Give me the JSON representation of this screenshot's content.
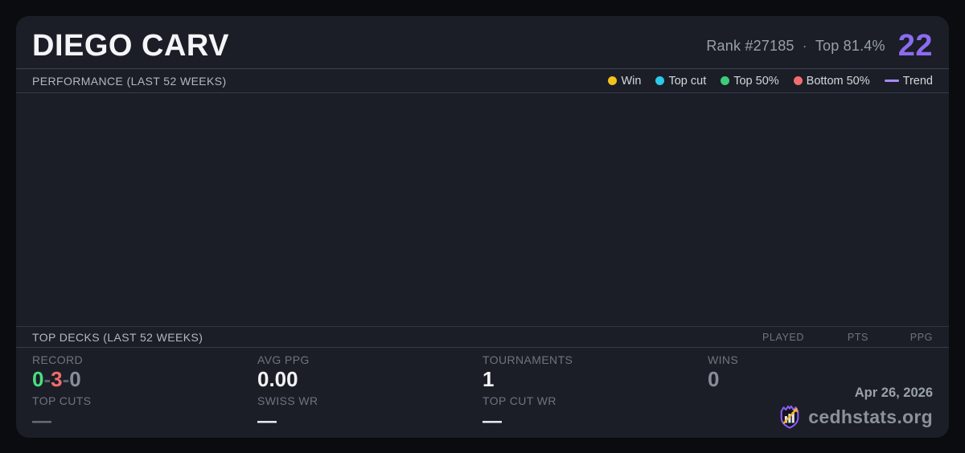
{
  "header": {
    "player_name": "DIEGO CARV",
    "rank_label": "Rank #27185",
    "separator": "·",
    "top_percent": "Top 81.4%",
    "score": "22"
  },
  "performance": {
    "title": "PERFORMANCE (LAST 52 WEEKS)",
    "legend": [
      {
        "label": "Win",
        "color": "#f2c21d",
        "swatch": "dot"
      },
      {
        "label": "Top cut",
        "color": "#2cc9e9",
        "swatch": "dot"
      },
      {
        "label": "Top 50%",
        "color": "#3ecc7a",
        "swatch": "dot"
      },
      {
        "label": "Bottom 50%",
        "color": "#f26d6d",
        "swatch": "dot"
      },
      {
        "label": "Trend",
        "color": "#a78bfa",
        "swatch": "line"
      }
    ],
    "chart_empty": true
  },
  "top_decks": {
    "title": "TOP DECKS (LAST 52 WEEKS)",
    "columns": [
      "PLAYED",
      "PTS",
      "PPG"
    ],
    "rows": []
  },
  "stats": {
    "record": {
      "label": "RECORD",
      "win": "0",
      "loss": "3",
      "draw": "0",
      "sep": "-"
    },
    "top_cuts": {
      "label": "TOP CUTS",
      "value": "—"
    },
    "avg_ppg": {
      "label": "AVG PPG",
      "value": "0.00"
    },
    "swiss_wr": {
      "label": "SWISS WR",
      "value": "—"
    },
    "tournaments": {
      "label": "TOURNAMENTS",
      "value": "1"
    },
    "top_cut_wr": {
      "label": "TOP CUT WR",
      "value": "—"
    },
    "wins": {
      "label": "WINS",
      "value": "0"
    }
  },
  "footer": {
    "date": "Apr 26, 2026",
    "site": "cedhstats.org"
  },
  "colors": {
    "page_bg": "#0b0c10",
    "card_bg": "#1b1e27",
    "accent_purple": "#8b6cf0",
    "win_yellow": "#f2c21d",
    "top_cut_cyan": "#2cc9e9",
    "top50_green": "#3ecc7a",
    "bottom50_red": "#f26d6d",
    "trend_lavender": "#a78bfa",
    "record_win_green": "#4ade80",
    "record_loss_red": "#f06c6c",
    "logo_shield_purple": "#8a5cf5",
    "logo_arrow_gold": "#f0b429"
  }
}
